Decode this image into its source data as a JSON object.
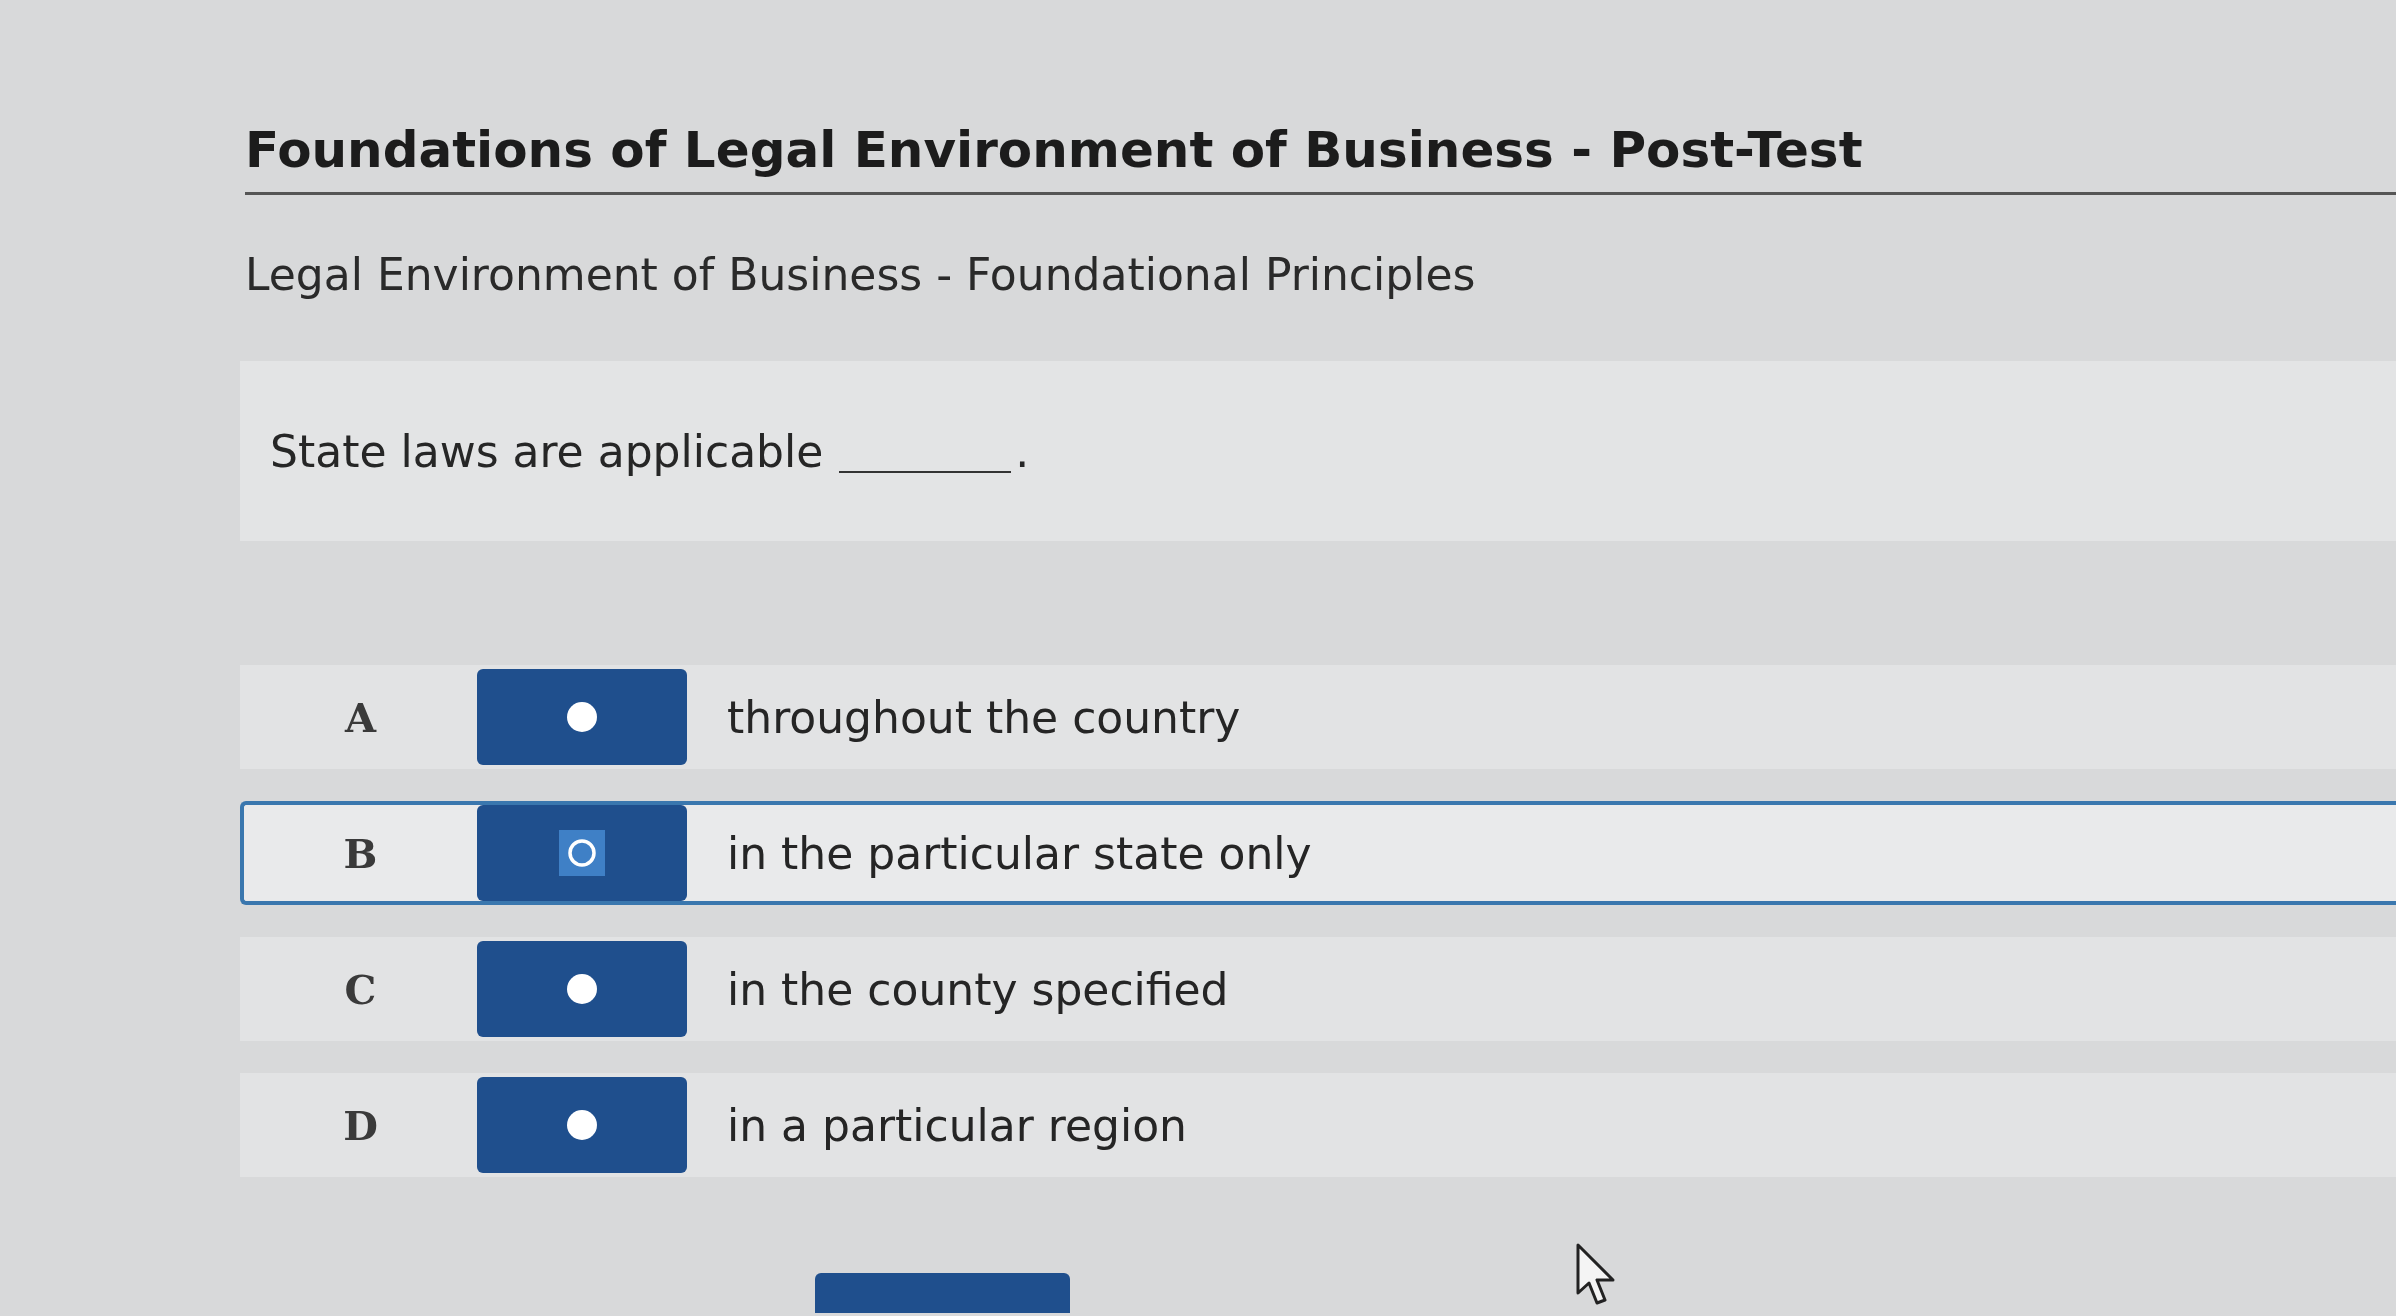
{
  "header": {
    "title": "Foundations of Legal Environment of Business - Post-Test",
    "subtitle": "Legal Environment of Business - Foundational Principles"
  },
  "question": {
    "text": "State laws are applicable",
    "after_blank": "."
  },
  "options": [
    {
      "letter": "A",
      "text": "throughout the country",
      "selected": false
    },
    {
      "letter": "B",
      "text": "in the particular state only",
      "selected": true
    },
    {
      "letter": "C",
      "text": "in the county specified",
      "selected": false
    },
    {
      "letter": "D",
      "text": "in a particular region",
      "selected": false
    }
  ]
}
